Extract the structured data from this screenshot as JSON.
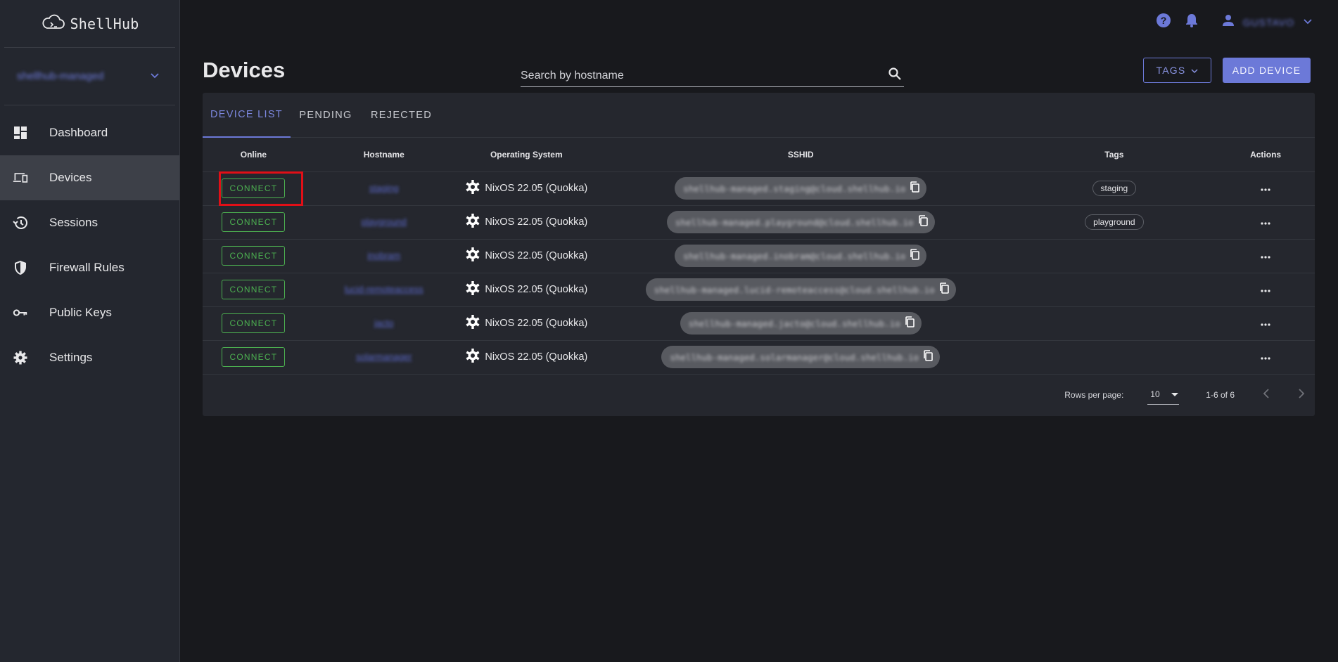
{
  "app": {
    "logo_text": "ShellHub"
  },
  "namespace": {
    "name": "shellhub-managed"
  },
  "sidebar": {
    "items": [
      {
        "label": "Dashboard",
        "icon": "dashboard-icon",
        "active": false
      },
      {
        "label": "Devices",
        "icon": "devices-icon",
        "active": true
      },
      {
        "label": "Sessions",
        "icon": "history-icon",
        "active": false
      },
      {
        "label": "Firewall Rules",
        "icon": "shield-icon",
        "active": false
      },
      {
        "label": "Public Keys",
        "icon": "key-icon",
        "active": false
      },
      {
        "label": "Settings",
        "icon": "gear-icon",
        "active": false
      }
    ]
  },
  "topbar": {
    "user_name": "GUSTAVO"
  },
  "page": {
    "title": "Devices",
    "search_placeholder": "Search by hostname",
    "tags_button": "TAGS",
    "add_button": "ADD DEVICE"
  },
  "tabs": [
    {
      "label": "DEVICE LIST",
      "active": true
    },
    {
      "label": "PENDING",
      "active": false
    },
    {
      "label": "REJECTED",
      "active": false
    }
  ],
  "table": {
    "headers": [
      "Online",
      "Hostname",
      "Operating System",
      "SSHID",
      "Tags",
      "Actions"
    ],
    "connect_label": "CONNECT",
    "rows": [
      {
        "hostname": "staging",
        "os": "NixOS 22.05 (Quokka)",
        "sshid": "shellhub-managed.staging@cloud.shellhub.io",
        "tag": "staging"
      },
      {
        "hostname": "playground",
        "os": "NixOS 22.05 (Quokka)",
        "sshid": "shellhub-managed.playground@cloud.shellhub.io",
        "tag": "playground"
      },
      {
        "hostname": "inobram",
        "os": "NixOS 22.05 (Quokka)",
        "sshid": "shellhub-managed.inobram@cloud.shellhub.io",
        "tag": ""
      },
      {
        "hostname": "lucid-remoteaccess",
        "os": "NixOS 22.05 (Quokka)",
        "sshid": "shellhub-managed.lucid-remoteaccess@cloud.shellhub.io",
        "tag": ""
      },
      {
        "hostname": "jacto",
        "os": "NixOS 22.05 (Quokka)",
        "sshid": "shellhub-managed.jacto@cloud.shellhub.io",
        "tag": ""
      },
      {
        "hostname": "solarmanager",
        "os": "NixOS 22.05 (Quokka)",
        "sshid": "shellhub-managed.solarmanager@cloud.shellhub.io",
        "tag": ""
      }
    ]
  },
  "pagination": {
    "rows_per_page_label": "Rows per page:",
    "rows_per_page_value": "10",
    "range": "1-6 of 6"
  },
  "colors": {
    "accent": "#6c79d8",
    "online": "#4caf50",
    "highlight": "#e10f17"
  }
}
